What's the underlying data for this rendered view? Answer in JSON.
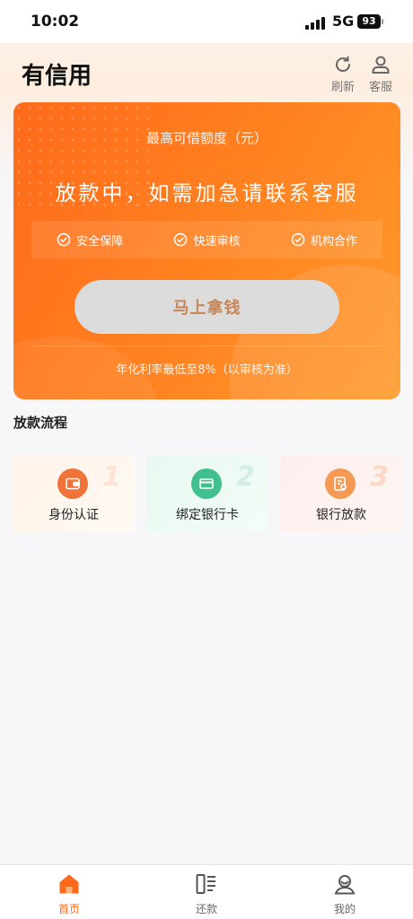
{
  "status_bar": {
    "time": "10:02",
    "network": "5G",
    "battery": "93"
  },
  "header": {
    "title": "有信用",
    "refresh_label": "刷新",
    "service_label": "客服"
  },
  "hero": {
    "subtitle": "最高可借额度（元）",
    "main_text": "放款中，如需加急请联系客服",
    "features": [
      "安全保障",
      "快速审核",
      "机构合作"
    ],
    "button_label": "马上拿钱",
    "rate_note": "年化利率最低至8%（以审核为准）"
  },
  "process": {
    "title": "放款流程",
    "steps": [
      {
        "label": "身份认证",
        "number": "1",
        "icon": "wallet-icon"
      },
      {
        "label": "绑定银行卡",
        "number": "2",
        "icon": "bank-card-icon"
      },
      {
        "label": "银行放款",
        "number": "3",
        "icon": "money-document-icon"
      }
    ]
  },
  "tabbar": {
    "items": [
      {
        "label": "首页",
        "icon": "home-icon",
        "active": true
      },
      {
        "label": "还款",
        "icon": "bill-icon",
        "active": false
      },
      {
        "label": "我的",
        "icon": "profile-icon",
        "active": false
      }
    ]
  },
  "colors": {
    "accent": "#ff6a1a",
    "step1": "#f0733a",
    "step2": "#3fc08e",
    "step3": "#f59a55"
  }
}
